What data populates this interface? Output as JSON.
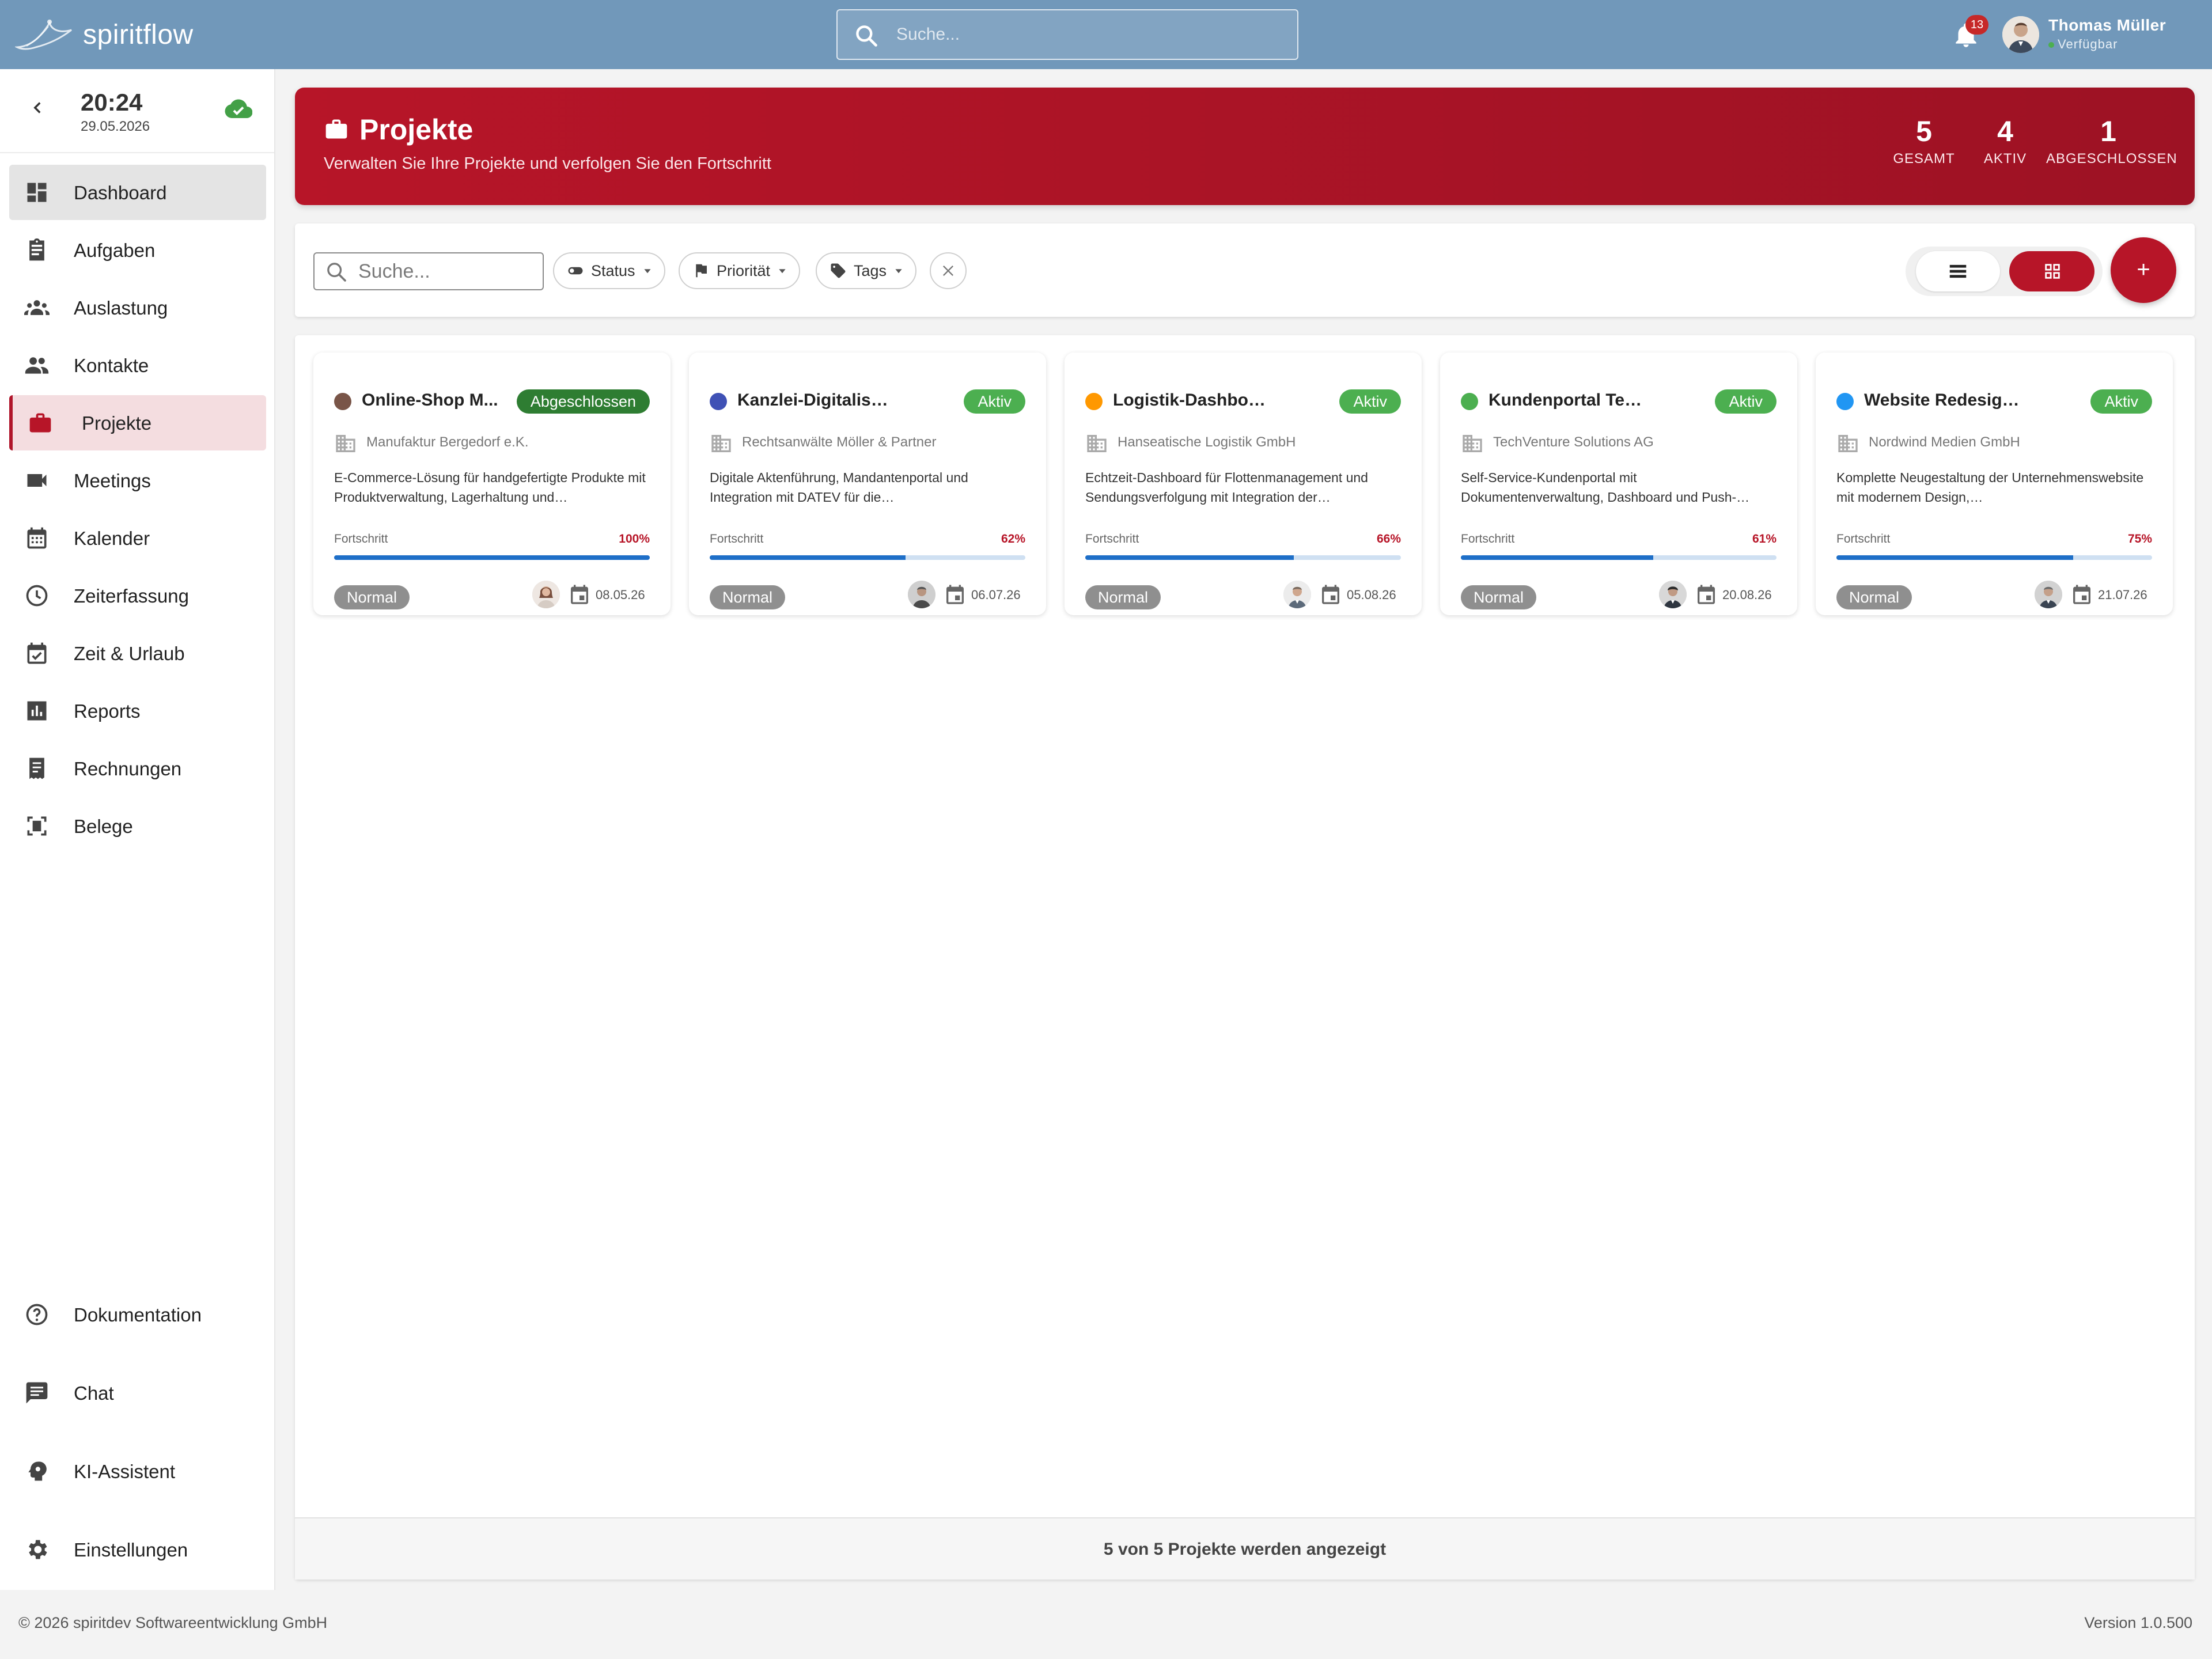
{
  "app": {
    "name": "spiritflow"
  },
  "topbar": {
    "search_placeholder": "Suche...",
    "notification_count": "13",
    "user_name": "Thomas Müller",
    "user_status": "Verfügbar"
  },
  "sidebar": {
    "time": "20:24",
    "date": "29.05.2026",
    "items": [
      {
        "label": "Dashboard",
        "icon": "dashboard-icon"
      },
      {
        "label": "Aufgaben",
        "icon": "clipboard-icon"
      },
      {
        "label": "Auslastung",
        "icon": "groups-icon"
      },
      {
        "label": "Kontakte",
        "icon": "people-icon"
      },
      {
        "label": "Projekte",
        "icon": "briefcase-icon"
      },
      {
        "label": "Meetings",
        "icon": "video-icon"
      },
      {
        "label": "Kalender",
        "icon": "calendar-icon"
      },
      {
        "label": "Zeiterfassung",
        "icon": "clock-icon"
      },
      {
        "label": "Zeit & Urlaub",
        "icon": "event-check-icon"
      },
      {
        "label": "Reports",
        "icon": "bar-chart-icon"
      },
      {
        "label": "Rechnungen",
        "icon": "receipt-icon"
      },
      {
        "label": "Belege",
        "icon": "document-scan-icon"
      }
    ],
    "bottom_items": [
      {
        "label": "Dokumentation",
        "icon": "help-icon"
      },
      {
        "label": "Chat",
        "icon": "chat-icon"
      },
      {
        "label": "KI-Assistent",
        "icon": "ai-head-icon"
      },
      {
        "label": "Einstellungen",
        "icon": "gear-icon"
      }
    ]
  },
  "header": {
    "title": "Projekte",
    "subtitle": "Verwalten Sie Ihre Projekte und verfolgen Sie den Fortschritt",
    "stats": [
      {
        "value": "5",
        "label": "GESAMT"
      },
      {
        "value": "4",
        "label": "AKTIV"
      },
      {
        "value": "1",
        "label": "ABGESCHLOSSEN"
      }
    ]
  },
  "toolbar": {
    "search_placeholder": "Suche...",
    "filters": [
      {
        "label": "Status",
        "icon": "toggle-icon"
      },
      {
        "label": "Priorität",
        "icon": "flag-icon"
      },
      {
        "label": "Tags",
        "icon": "tag-icon"
      }
    ],
    "add_label": "+"
  },
  "projects": [
    {
      "title": "Online-Shop Manufaktur Bergedorf",
      "title_display": "Online-Shop M...",
      "status": "Abgeschlossen",
      "status_type": "done",
      "dot_color": "#795548",
      "company": "Manufaktur Bergedorf e.K.",
      "description": "E-Commerce-Lösung für handgefertigte Produkte mit Produktverwaltung, Lagerhaltung und…",
      "progress_label": "Fortschritt",
      "progress": 100,
      "progress_text": "100%",
      "priority": "Normal",
      "date": "08.05.26"
    },
    {
      "title": "Kanzlei-Digitalisierung",
      "title_display": "Kanzlei-Digitalisierung",
      "status": "Aktiv",
      "status_type": "act",
      "dot_color": "#3f51b5",
      "company": "Rechtsanwälte Möller & Partner",
      "description": "Digitale Aktenführung, Mandantenportal und Integration mit DATEV für die…",
      "progress_label": "Fortschritt",
      "progress": 62,
      "progress_text": "62%",
      "priority": "Normal",
      "date": "06.07.26"
    },
    {
      "title": "Logistik-Dashboard",
      "title_display": "Logistik-Dashboard",
      "status": "Aktiv",
      "status_type": "act",
      "dot_color": "#ff9800",
      "company": "Hanseatische Logistik GmbH",
      "description": "Echtzeit-Dashboard für Flottenmanagement und Sendungsverfolgung mit Integration der…",
      "progress_label": "Fortschritt",
      "progress": 66,
      "progress_text": "66%",
      "priority": "Normal",
      "date": "05.08.26"
    },
    {
      "title": "Kundenportal TechVenture",
      "title_display": "Kundenportal TechVenture",
      "status": "Aktiv",
      "status_type": "act",
      "dot_color": "#4caf50",
      "company": "TechVenture Solutions AG",
      "description": "Self-Service-Kundenportal mit Dokumentenverwaltung, Dashboard und Push-…",
      "progress_label": "Fortschritt",
      "progress": 61,
      "progress_text": "61%",
      "priority": "Normal",
      "date": "20.08.26"
    },
    {
      "title": "Website Redesign Nordwind",
      "title_display": "Website Redesign Nordw...",
      "status": "Aktiv",
      "status_type": "act",
      "dot_color": "#2196f3",
      "company": "Nordwind Medien GmbH",
      "description": "Komplette Neugestaltung der Unternehmenswebsite mit modernem Design,…",
      "progress_label": "Fortschritt",
      "progress": 75,
      "progress_text": "75%",
      "priority": "Normal",
      "date": "21.07.26"
    }
  ],
  "content_footer": "5 von 5 Projekte werden angezeigt",
  "footer": {
    "copyright": "© 2026 spiritdev Softwareentwicklung GmbH",
    "version": "Version 1.0.500"
  },
  "colors": {
    "topbar": "#7198ba",
    "accent": "#b71528",
    "done_badge": "#2e7d32",
    "active_badge": "#4caf50",
    "progress": "#1e6fc8"
  }
}
